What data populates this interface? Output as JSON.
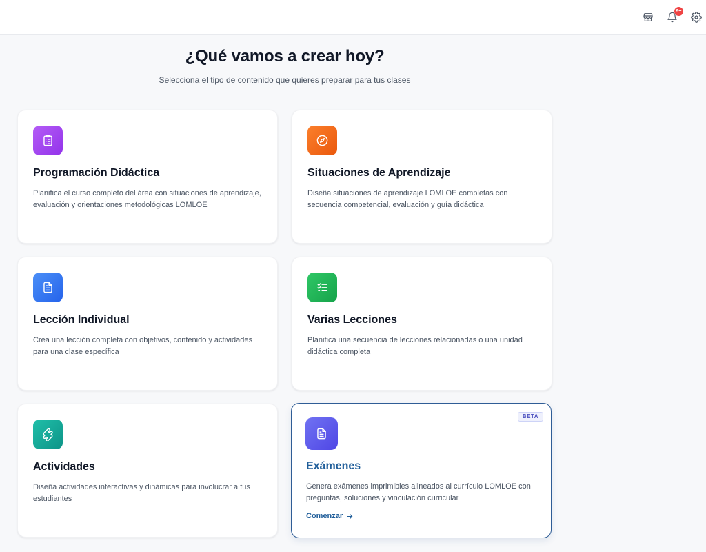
{
  "header": {
    "notification_count": "9+",
    "icons": [
      "store-icon",
      "bell-icon",
      "gear-icon"
    ]
  },
  "main": {
    "title": "¿Qué vamos a crear hoy?",
    "subtitle": "Selecciona el tipo de contenido que quieres preparar para tus clases"
  },
  "cards": [
    {
      "title": "Programación Didáctica",
      "description": "Planifica el curso completo del área con situaciones de aprendizaje, evaluación y orientaciones metodológicas LOMLOE",
      "icon": "clipboard-list-icon",
      "color": "#a855f7"
    },
    {
      "title": "Situaciones de Aprendizaje",
      "description": "Diseña situaciones de aprendizaje LOMLOE completas con secuencia competencial, evaluación y guía didáctica",
      "icon": "compass-icon",
      "color": "#f97316"
    },
    {
      "title": "Lección Individual",
      "description": "Crea una lección completa con objetivos, contenido y actividades para una clase específica",
      "icon": "document-icon",
      "color": "#3b82f6"
    },
    {
      "title": "Varias Lecciones",
      "description": "Planifica una secuencia de lecciones relacionadas o una unidad didáctica completa",
      "icon": "checklist-icon",
      "color": "#22c55e"
    },
    {
      "title": "Actividades",
      "description": "Diseña actividades interactivas y dinámicas para involucrar a tus estudiantes",
      "icon": "puzzle-icon",
      "color": "#14b8a6"
    },
    {
      "title": "Exámenes",
      "description": "Genera exámenes imprimibles alineados al currículo LOMLOE con preguntas, soluciones y vinculación curricular",
      "icon": "exam-document-icon",
      "color": "#6366f1",
      "badge": "BETA",
      "action": "Comenzar"
    }
  ]
}
